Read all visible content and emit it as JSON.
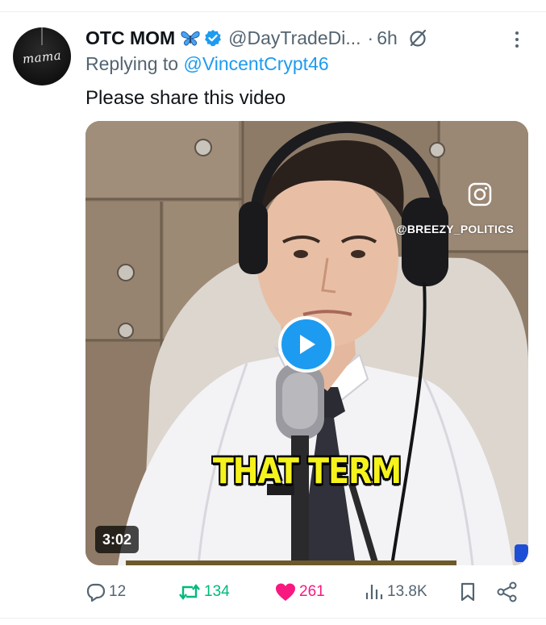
{
  "tweet": {
    "display_name": "OTC MOM",
    "handle": "@DayTradeDi...",
    "separator": "·",
    "time": "6h",
    "reply_prefix": "Replying to",
    "reply_mention": "@VincentCrypt46",
    "text": "Please share this video",
    "avatar_text": "mama"
  },
  "media": {
    "watermark": "@BREEZY_POLITICS",
    "caption": "THAT TERM",
    "duration": "3:02"
  },
  "actions": {
    "replies": "12",
    "reposts": "134",
    "likes": "261",
    "views": "13.8K"
  },
  "colors": {
    "accent": "#1d9bf0",
    "repost": "#00ba7c",
    "like": "#f91880",
    "muted": "#536471",
    "caption": "#f5f21c"
  },
  "icons": [
    "butterfly-emoji-icon",
    "verified-badge-icon",
    "grok-icon",
    "more-icon",
    "instagram-icon",
    "play-icon",
    "reply-icon",
    "repost-icon",
    "like-icon",
    "views-icon",
    "bookmark-icon",
    "share-icon"
  ]
}
